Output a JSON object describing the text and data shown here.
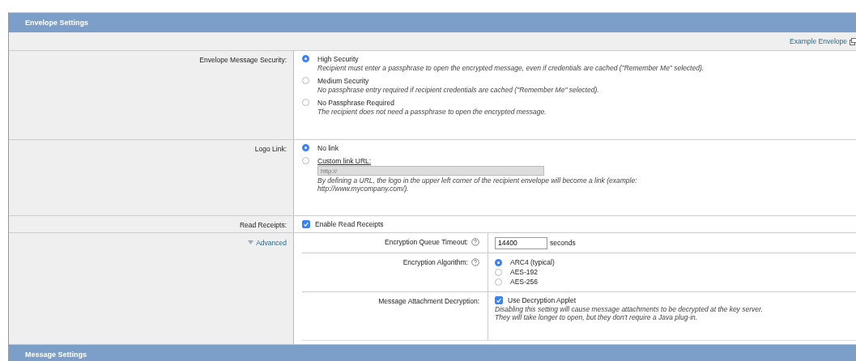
{
  "section_title": "Envelope Settings",
  "example_link": "Example Envelope",
  "security": {
    "label": "Envelope Message Security:",
    "options": [
      {
        "title": "High Security",
        "desc": "Recipient must enter a passphrase to open the encrypted message, even if credentials are cached (\"Remember Me\" selected).",
        "selected": true
      },
      {
        "title": "Medium Security",
        "desc": "No passphrase entry required if recipient credentials are cached (\"Remember Me\" selected).",
        "selected": false
      },
      {
        "title": "No Passphrase Required",
        "desc": "The recipient does not need a passphrase to open the encrypted message.",
        "selected": false
      }
    ]
  },
  "logo_link": {
    "label": "Logo Link:",
    "options": [
      {
        "kind": "plain",
        "title": "No link",
        "selected": true
      },
      {
        "kind": "url",
        "title": "Custom link URL:",
        "selected": false,
        "placeholder": "http://",
        "desc": "By defining a URL, the logo in the upper left corner of the recipient envelope will become a link (example: http://www.mycompany.com/)."
      }
    ]
  },
  "read_receipts": {
    "label": "Read Receipts:",
    "option": "Enable Read Receipts",
    "checked": true
  },
  "advanced": {
    "toggle": "Advanced",
    "expanded": true,
    "timeout": {
      "label": "Encryption Queue Timeout:",
      "value": "14400",
      "unit": "seconds"
    },
    "algorithm": {
      "label": "Encryption Algorithm:",
      "options": [
        {
          "title": "ARC4 (typical)",
          "selected": true
        },
        {
          "title": "AES-192",
          "selected": false
        },
        {
          "title": "AES-256",
          "selected": false
        }
      ]
    },
    "attachment": {
      "label": "Message Attachment Decryption:",
      "option": "Use Decryption Applet",
      "checked": true,
      "desc": "Disabling this setting will cause message attachments to be decrypted at the key server. They will take longer to open, but they don't require a Java plug-in."
    }
  },
  "next_section_title": "Message Settings"
}
